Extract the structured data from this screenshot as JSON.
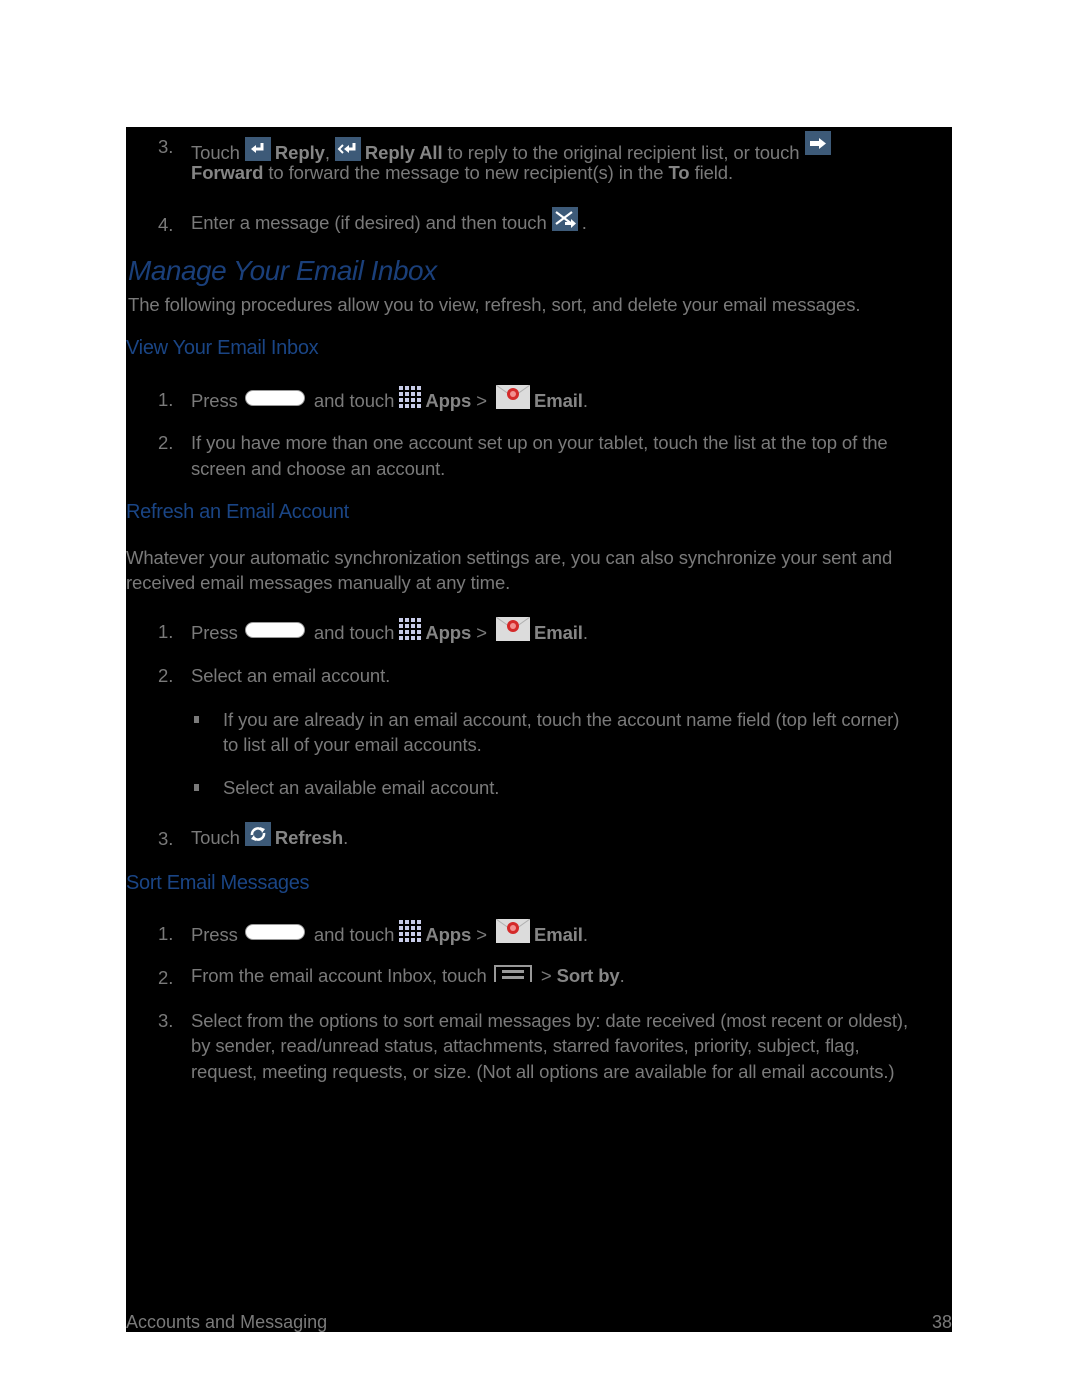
{
  "top_steps": [
    {
      "num": "3.",
      "pre": "Touch",
      "reply": "Reply",
      "comma": ",",
      "reply_all": "Reply All",
      "mid": "to reply to the original recipient list, or touch",
      "forward": "Forward",
      "post": "to forward the message to new recipient(s) in the",
      "to": "To",
      "end": "field."
    },
    {
      "num": "4.",
      "text": "Enter a message (if desired) and then touch",
      "end": "."
    }
  ],
  "section": {
    "title": "Manage Your Email Inbox",
    "intro": "The following procedures allow you to view, refresh, sort, and delete your email messages."
  },
  "view_inbox": {
    "heading": "View Your Email Inbox",
    "step1": {
      "num": "1.",
      "press": "Press",
      "and_touch": "and touch",
      "apps": "Apps",
      "sep": ">",
      "email": "Email",
      "end": "."
    },
    "step2": {
      "num": "2.",
      "line1": "If you have more than one account set up on your tablet, touch the list at the top of the",
      "line2": "screen and choose an account."
    }
  },
  "refresh": {
    "heading": "Refresh an Email Account",
    "intro_line1": "Whatever your automatic synchronization settings are, you can also synchronize your sent and",
    "intro_line2": "received email messages manually at any time.",
    "step1": {
      "num": "1.",
      "press": "Press",
      "and_touch": "and touch",
      "apps": "Apps",
      "sep": ">",
      "email": "Email",
      "end": "."
    },
    "step2": {
      "num": "2.",
      "text": "Select an email account."
    },
    "bullets": [
      {
        "line1": "If you are already in an email account, touch the account name field (top left corner)",
        "line2": "to list all of your email accounts."
      },
      {
        "line1": "Select an available email account."
      }
    ],
    "step3": {
      "num": "3.",
      "pre": "Touch",
      "refresh": "Refresh",
      "end": "."
    }
  },
  "sort": {
    "heading": "Sort Email Messages",
    "step1": {
      "num": "1.",
      "press": "Press",
      "and_touch": "and touch",
      "apps": "Apps",
      "sep": ">",
      "email": "Email",
      "end": "."
    },
    "step2": {
      "num": "2.",
      "pre": "From the email account Inbox, touch",
      "sep": ">",
      "sort_by": "Sort by",
      "end": "."
    },
    "step3": {
      "num": "3.",
      "line1": "Select from the options to sort email messages by: date received (most recent or oldest),",
      "line2": "by sender, read/unread status, attachments, starred favorites, priority, subject, flag,",
      "line3": "request, meeting requests, or size. (Not all options are available for all email accounts.)"
    }
  },
  "footer": {
    "section": "Accounts and Messaging",
    "page": "38"
  },
  "icons": {
    "reply": "reply-icon",
    "reply_all": "reply-all-icon",
    "forward": "forward-icon",
    "send": "send-icon",
    "home": "home-key-icon",
    "apps": "apps-grid-icon",
    "email": "email-envelope-icon",
    "refresh": "refresh-icon",
    "menu": "menu-icon"
  },
  "colors": {
    "page_bg": "#000000",
    "body_text": "#7a7a7a",
    "heading": "#1a4585",
    "icon_bg": "#3d5a78"
  }
}
